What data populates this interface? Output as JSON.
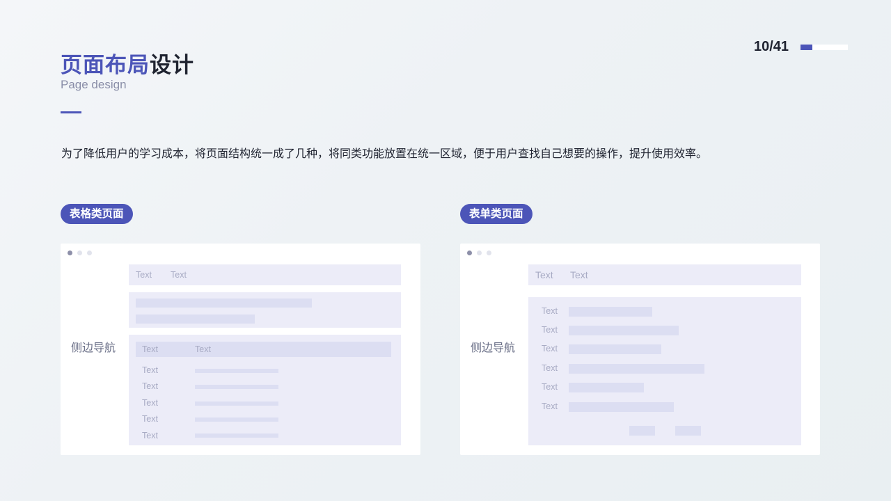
{
  "header": {
    "title_accent": "页面布局",
    "title_rest": "设计",
    "subtitle": "Page design",
    "page_number": "10/41",
    "progress": 0.25
  },
  "description": "为了降低用户的学习成本，将页面结构统一成了几种，将同类功能放置在统一区域，便于用户查找自己想要的操作，提升使用效率。",
  "table_page": {
    "tag": "表格类页面",
    "side_nav": "侧边导航",
    "header_row": [
      "Text",
      "Text"
    ],
    "table_header": [
      "Text",
      "Text"
    ],
    "rows": [
      "Text",
      "Text",
      "Text",
      "Text",
      "Text"
    ]
  },
  "form_page": {
    "tag": "表单类页面",
    "side_nav": "侧边导航",
    "header_row": [
      "Text",
      "Text"
    ],
    "field_labels": [
      "Text",
      "Text",
      "Text",
      "Text",
      "Text",
      "Text"
    ]
  },
  "colors": {
    "accent": "#4c55b8",
    "block": "#ececf8",
    "bar": "#dcdef2"
  }
}
